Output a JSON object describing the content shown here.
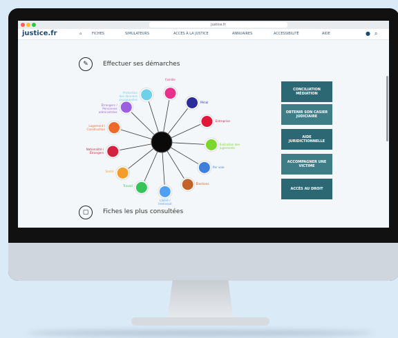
{
  "browser": {
    "url": "justice.fr"
  },
  "site": {
    "logo": "justice.fr",
    "nav": [
      {
        "label": "FICHES"
      },
      {
        "label": "SIMULATEURS"
      },
      {
        "label": "ACCÈS À LA JUSTICE"
      },
      {
        "label": "ANNUAIRES"
      },
      {
        "label": "ACCESSIBILITÉ"
      },
      {
        "label": "AIDE"
      }
    ]
  },
  "sections": {
    "demarches": "Effectuer ses démarches",
    "fiches": "Fiches les plus consultées"
  },
  "wheel": {
    "nodes": [
      {
        "label": "Famille",
        "color": "#e8308b",
        "label_color": "#e8308b"
      },
      {
        "label": "Pénal",
        "color": "#2c2b9a",
        "label_color": "#2c2b9a"
      },
      {
        "label": "Entreprise",
        "color": "#e0193a",
        "label_color": "#e0193a"
      },
      {
        "label": "Exécution des\njugements",
        "color": "#7bd62e",
        "label_color": "#7bd62e"
      },
      {
        "label": "Par voie",
        "color": "#3d7fdb",
        "label_color": "#3d7fdb"
      },
      {
        "label": "Élections",
        "color": "#c1622a",
        "label_color": "#c1622a"
      },
      {
        "label": "Libéré /\nIntéressé",
        "color": "#4f9ff3",
        "label_color": "#4f9ff3"
      },
      {
        "label": "Travail",
        "color": "#36c35a",
        "label_color": "#36c35a"
      },
      {
        "label": "Santé",
        "color": "#f39d2d",
        "label_color": "#f39d2d"
      },
      {
        "label": "Nationalité /\nÉtrangers",
        "color": "#d4213e",
        "label_color": "#d4213e"
      },
      {
        "label": "Logement /\nConstruction",
        "color": "#ee6a2a",
        "label_color": "#ee6a2a"
      },
      {
        "label": "Étrangers /\nPersonnes\nadministrées",
        "color": "#9b5fe0",
        "label_color": "#9b5fe0"
      },
      {
        "label": "Protection\ndes données\npersonnelles",
        "color": "#6ed0ea",
        "label_color": "#6ed0ea"
      }
    ]
  },
  "tiles": [
    {
      "label": "CONCILIATION MÉDIATION"
    },
    {
      "label": "OBTENIR SON CASIER JUDICIAIRE"
    },
    {
      "label": "AIDE JURIDICTIONNELLE"
    },
    {
      "label": "ACCOMPAGNER UNE VICTIME"
    },
    {
      "label": "ACCÈS AU DROIT"
    }
  ]
}
